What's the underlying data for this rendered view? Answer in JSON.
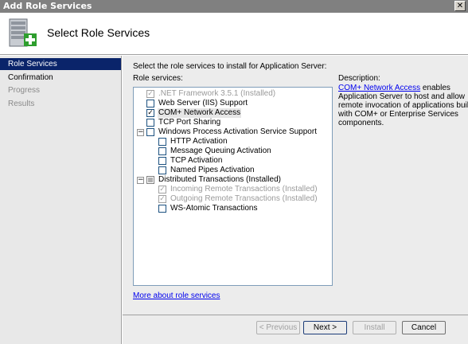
{
  "window": {
    "title": "Add Role Services"
  },
  "header": {
    "title": "Select Role Services"
  },
  "sidebar": {
    "items": [
      {
        "label": "Role Services",
        "state": "active"
      },
      {
        "label": "Confirmation",
        "state": "normal"
      },
      {
        "label": "Progress",
        "state": "disabled"
      },
      {
        "label": "Results",
        "state": "disabled"
      }
    ]
  },
  "main": {
    "instruction": "Select the role services to install for Application Server:",
    "list_label": "Role services:",
    "services": [
      {
        "label": ".NET Framework 3.5.1  (Installed)",
        "checked": true,
        "disabled": true
      },
      {
        "label": "Web Server (IIS) Support",
        "checked": false
      },
      {
        "label": "COM+ Network Access",
        "checked": true,
        "selected": true
      },
      {
        "label": "TCP Port Sharing",
        "checked": false
      },
      {
        "label": "Windows Process Activation Service Support",
        "checked": false,
        "expander": "−"
      },
      {
        "label": "HTTP Activation",
        "checked": false
      },
      {
        "label": "Message Queuing Activation",
        "checked": false
      },
      {
        "label": "TCP Activation",
        "checked": false
      },
      {
        "label": "Named Pipes Activation",
        "checked": false
      },
      {
        "label": "Distributed Transactions  (Installed)",
        "checked": "partial",
        "expander": "−"
      },
      {
        "label": "Incoming Remote Transactions  (Installed)",
        "checked": true,
        "disabled": true
      },
      {
        "label": "Outgoing Remote Transactions  (Installed)",
        "checked": true,
        "disabled": true
      },
      {
        "label": "WS-Atomic Transactions",
        "checked": false
      }
    ],
    "more_link": "More about role services",
    "description": {
      "label": "Description:",
      "link": "COM+ Network Access",
      "line1_rest": " enables",
      "line2": "Application Server to host and allow",
      "line3": "remote invocation of applications built",
      "line4": "with COM+ or Enterprise Services",
      "line5": "components."
    }
  },
  "footer": {
    "previous": "< Previous",
    "next": "Next >",
    "install": "Install",
    "cancel": "Cancel"
  },
  "icons": {
    "close": "close-icon",
    "header": "server-add-icon",
    "check": "checkmark-icon"
  },
  "colors": {
    "selection": "#0a246a",
    "link": "#0000ee"
  }
}
